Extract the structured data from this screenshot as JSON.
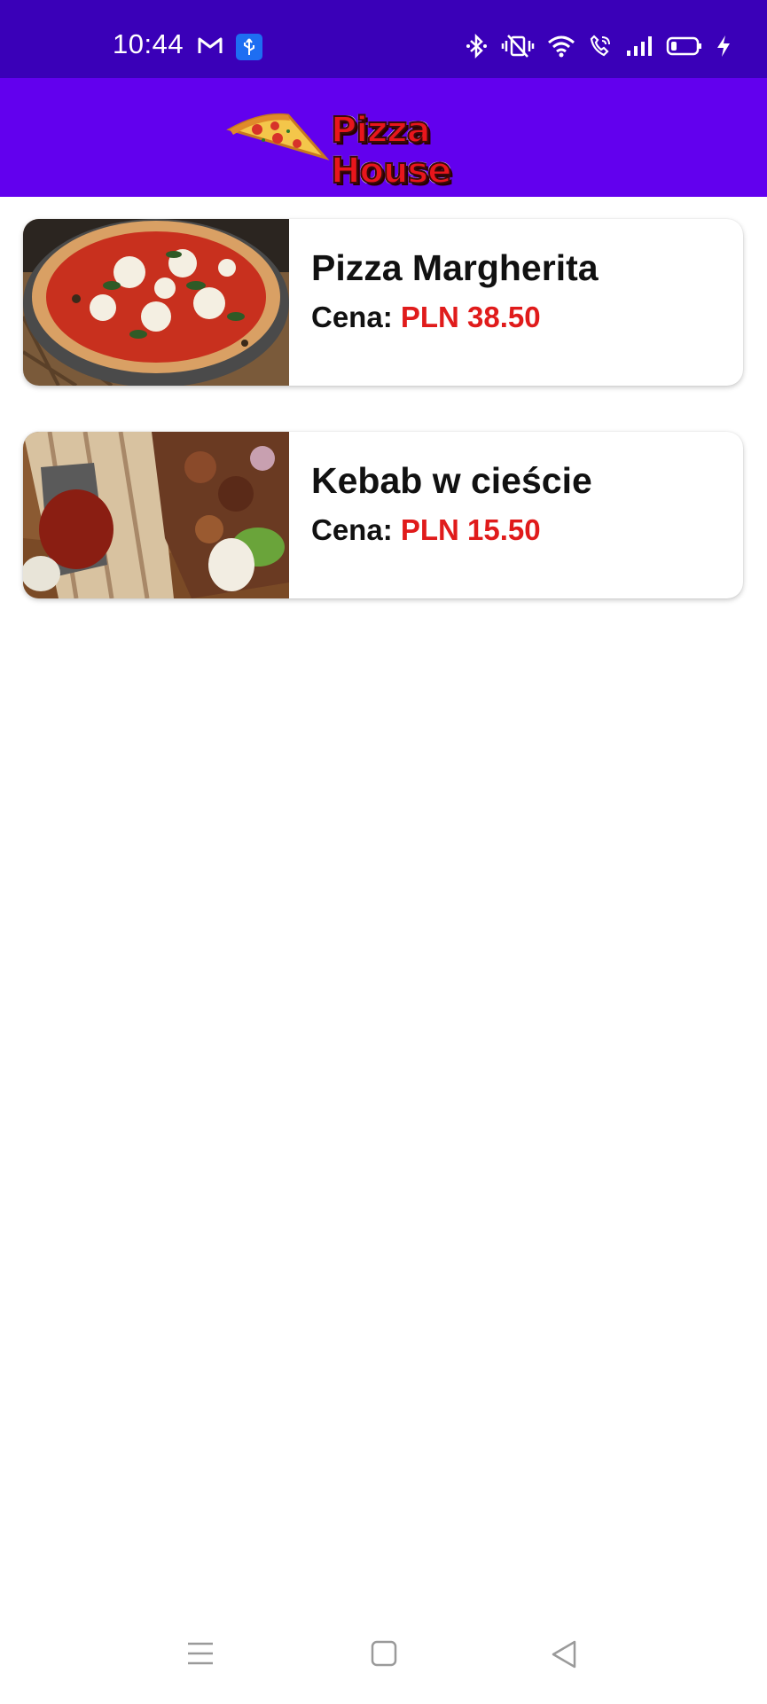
{
  "status_bar": {
    "time": "10:44",
    "left_icons": [
      "gmail-icon",
      "usb-icon"
    ],
    "right_icons": [
      "bluetooth-icon",
      "vibrate-icon",
      "wifi-icon",
      "wifi-calling-icon",
      "signal-icon",
      "battery-icon",
      "charging-icon"
    ]
  },
  "app_bar": {
    "logo_text": "Pizza House",
    "color": "#6200ee"
  },
  "menu_items": [
    {
      "name": "Pizza Margherita",
      "price_label": "Cena:",
      "price_value": "PLN 38.50"
    },
    {
      "name": "Kebab w cieście",
      "price_label": "Cena:",
      "price_value": "PLN 15.50"
    }
  ],
  "colors": {
    "status_bar": "#3a00b8",
    "price": "#e01b1b"
  },
  "nav_bar": {
    "buttons": [
      "menu-icon",
      "home-icon",
      "back-icon"
    ]
  }
}
